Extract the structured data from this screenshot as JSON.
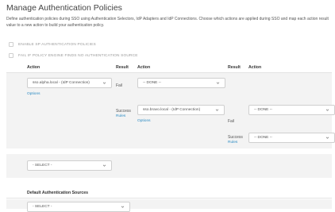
{
  "page": {
    "title": "Manage Authentication Policies",
    "description": "Define authentication policies during SSO using Authentication Selectors, IdP Adapters and IdP Connections. Choose which actions are applied during SSO and map each action result value to a new action to build your authentication policy."
  },
  "checkboxes": [
    {
      "label": "ENABLE SP AUTHENTICATION POLICIES",
      "checked": false
    },
    {
      "label": "FAIL IF POLICY ENGINE FINDS NO AUTHENTICATION SOURCE",
      "checked": false
    }
  ],
  "table_header": {
    "action": "Action",
    "result": "Result",
    "action2": "Action",
    "result2": "Result",
    "action3": "Action"
  },
  "policy": {
    "root_action": "sso.alpha.local - (IdP Connection)",
    "options": "Options",
    "fail_label": "Fail",
    "fail_action": "-- DONE --",
    "success_label": "Success",
    "rules": "Rules",
    "success_action": "sso.bravo.local - (IdP Connection)",
    "options2": "Options",
    "nested_fail_label": "Fail",
    "nested_fail_action": "-- DONE --",
    "nested_success_label": "Success",
    "rules2": "Rules",
    "nested_success_action": "-- DONE --"
  },
  "new_policy_select": "- SELECT -",
  "default_sources": {
    "heading": "Default Authentication Sources",
    "select": "- SELECT -"
  },
  "colors": {
    "link": "#2d8cc3",
    "band": "#f3f3f3",
    "border": "#cfcfcf"
  },
  "icons": [
    "chevron-down-icon"
  ]
}
